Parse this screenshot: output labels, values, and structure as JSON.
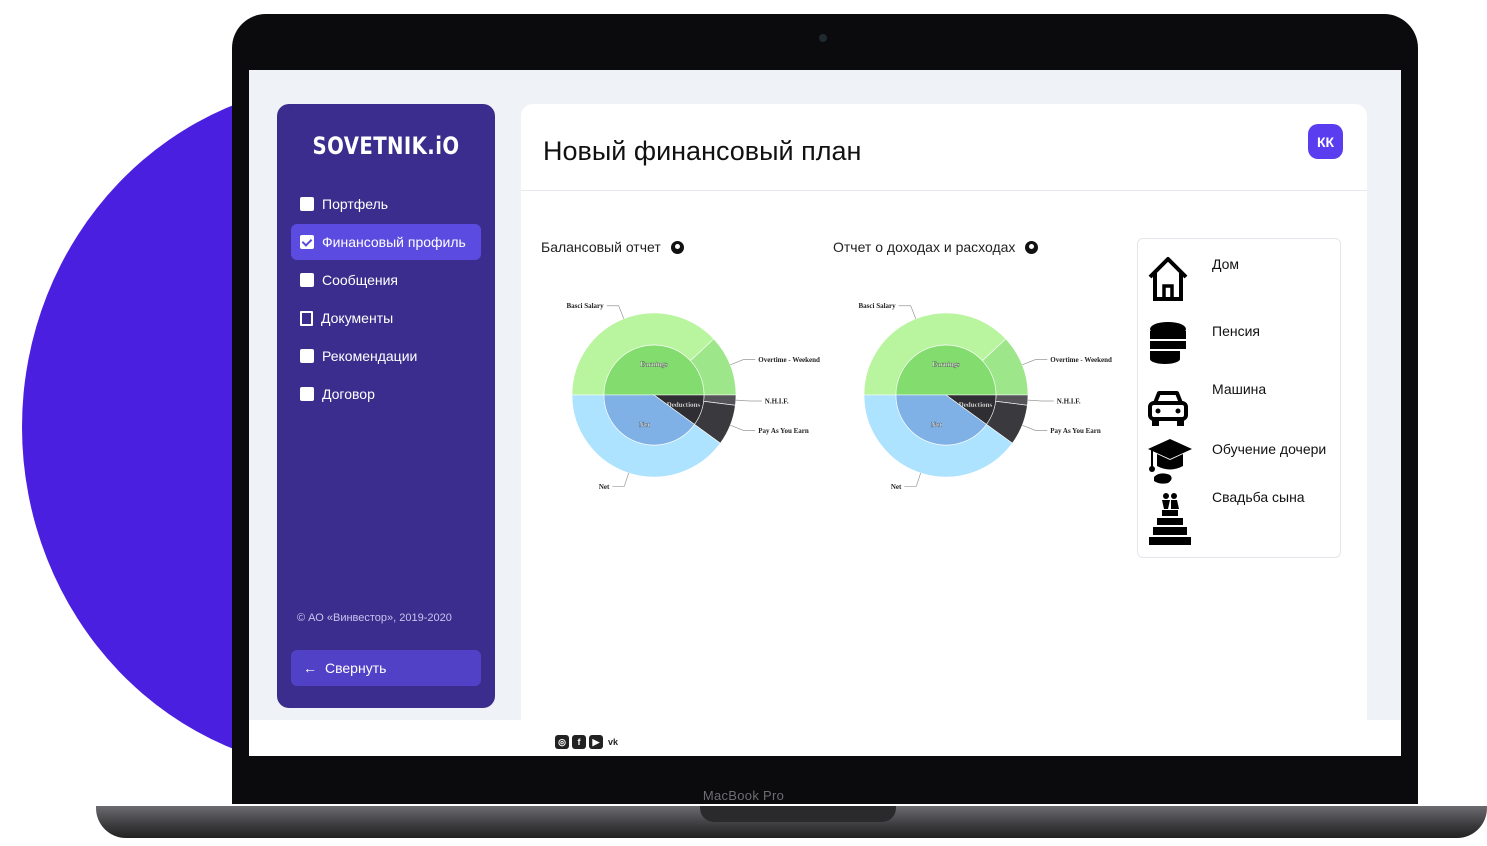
{
  "device": {
    "model_label": "MacBook Pro"
  },
  "brand": {
    "logo": "SOVETNIK.iO",
    "accent": "#5b3df0",
    "sidebar_bg": "#3b2d8d",
    "blob": "#4a1fe0"
  },
  "sidebar": {
    "items": [
      {
        "label": "Портфель",
        "icon": "briefcase-icon",
        "active": false
      },
      {
        "label": "Финансовый профиль",
        "icon": "checklist-icon",
        "active": true
      },
      {
        "label": "Сообщения",
        "icon": "chat-icon",
        "active": false
      },
      {
        "label": "Документы",
        "icon": "documents-icon",
        "active": false
      },
      {
        "label": "Рекомендации",
        "icon": "thumbs-up-icon",
        "active": false
      },
      {
        "label": "Договор",
        "icon": "clipboard-icon",
        "active": false
      }
    ],
    "copyright": "© АО «Винвестор», 2019-2020",
    "collapse_label": "Свернуть"
  },
  "header": {
    "title": "Новый финансовый план",
    "avatar_initials": "КК"
  },
  "chart_data": [
    {
      "type": "pie",
      "title": "Балансовый отчет",
      "inner_ring": [
        {
          "label": "Earnings",
          "value": 50,
          "color": "#82dc6e"
        },
        {
          "label": "Deductions",
          "value": 10,
          "color": "#2f2f33"
        },
        {
          "label": "Net",
          "value": 40,
          "color": "#7fb0e6"
        }
      ],
      "outer_ring": [
        {
          "label": "Basci Salary",
          "value": 38,
          "color": "#b9f49f"
        },
        {
          "label": "Overtime - Weekend",
          "value": 12,
          "color": "#9de68a"
        },
        {
          "label": "N.H.I.F.",
          "value": 2,
          "color": "#555559"
        },
        {
          "label": "Pay As You Earn",
          "value": 8,
          "color": "#3a3a3e"
        },
        {
          "label": "Net",
          "value": 40,
          "color": "#ade3ff"
        }
      ]
    },
    {
      "type": "pie",
      "title": "Отчет о доходах и расходах",
      "inner_ring": [
        {
          "label": "Earnings",
          "value": 50,
          "color": "#82dc6e"
        },
        {
          "label": "Deductions",
          "value": 10,
          "color": "#2f2f33"
        },
        {
          "label": "Net",
          "value": 40,
          "color": "#7fb0e6"
        }
      ],
      "outer_ring": [
        {
          "label": "Basci Salary",
          "value": 38,
          "color": "#b9f49f"
        },
        {
          "label": "Overtime - Weekend",
          "value": 12,
          "color": "#9de68a"
        },
        {
          "label": "N.H.I.F.",
          "value": 2,
          "color": "#555559"
        },
        {
          "label": "Pay As You Earn",
          "value": 8,
          "color": "#3a3a3e"
        },
        {
          "label": "Net",
          "value": 40,
          "color": "#ade3ff"
        }
      ]
    }
  ],
  "goals": [
    {
      "label": "Дом",
      "icon": "house-icon"
    },
    {
      "label": "Пенсия",
      "icon": "coins-icon"
    },
    {
      "label": "Машина",
      "icon": "car-icon"
    },
    {
      "label": "Обучение дочери",
      "icon": "graduation-cap-icon"
    },
    {
      "label": "Свадьба сына",
      "icon": "wedding-cake-icon"
    }
  ],
  "footer": {
    "social": [
      "instagram-icon",
      "facebook-icon",
      "youtube-icon",
      "vk-icon"
    ]
  }
}
